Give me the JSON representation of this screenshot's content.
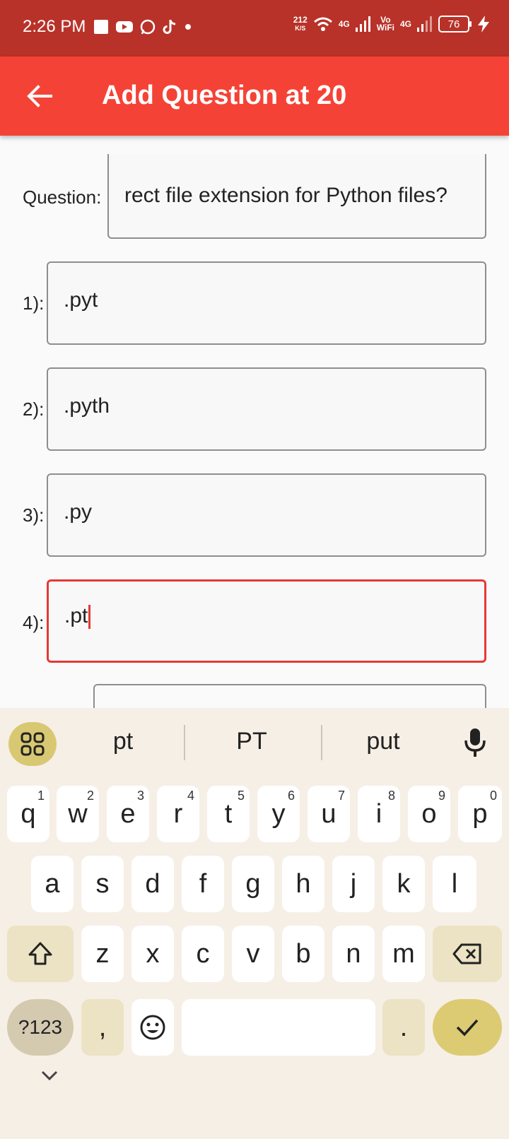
{
  "status_bar": {
    "time": "2:26 PM",
    "speed_value": "212",
    "speed_unit": "K/S",
    "net1": "4G",
    "volte": "Vo",
    "wifi": "WiFi",
    "net2": "4G",
    "battery": "76",
    "icons": [
      "stop-square-icon",
      "youtube-icon",
      "whatsapp-icon",
      "tiktok-icon",
      "dot-icon",
      "wifi-icon",
      "signal-icon",
      "bolt-icon"
    ]
  },
  "app_bar": {
    "title": "Add Question at 20",
    "back_icon": "arrow-left-icon"
  },
  "form": {
    "question_label": "Question:",
    "question_value": "rect file extension for Python files?",
    "options": [
      {
        "label": "1):",
        "value": ".pyt"
      },
      {
        "label": "2):",
        "value": ".pyth"
      },
      {
        "label": "3):",
        "value": ".py"
      },
      {
        "label": "4):",
        "value": ".pt"
      }
    ]
  },
  "keyboard": {
    "suggestions": [
      "pt",
      "PT",
      "put"
    ],
    "row1": [
      {
        "k": "q",
        "n": "1"
      },
      {
        "k": "w",
        "n": "2"
      },
      {
        "k": "e",
        "n": "3"
      },
      {
        "k": "r",
        "n": "4"
      },
      {
        "k": "t",
        "n": "5"
      },
      {
        "k": "y",
        "n": "6"
      },
      {
        "k": "u",
        "n": "7"
      },
      {
        "k": "i",
        "n": "8"
      },
      {
        "k": "o",
        "n": "9"
      },
      {
        "k": "p",
        "n": "0"
      }
    ],
    "row2": [
      "a",
      "s",
      "d",
      "f",
      "g",
      "h",
      "j",
      "k",
      "l"
    ],
    "row3": [
      "z",
      "x",
      "c",
      "v",
      "b",
      "n",
      "m"
    ],
    "sym_key": "?123",
    "comma_key": ",",
    "period_key": ".",
    "accent": "#dccb72",
    "active_color": "#e53935"
  }
}
